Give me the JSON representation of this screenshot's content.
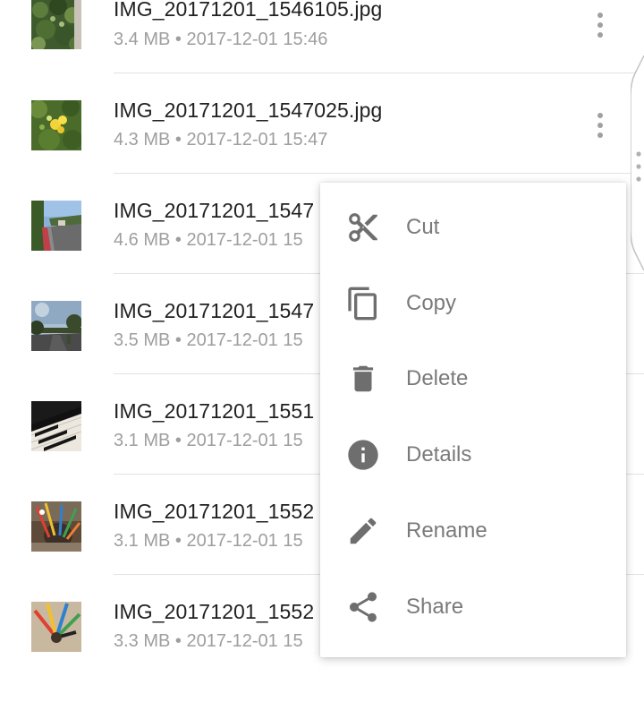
{
  "files": [
    {
      "name": "IMG_20171201_1546105.jpg",
      "size": "3.4 MB",
      "date": "2017-12-01 15:46",
      "thumb": "ivy-wall"
    },
    {
      "name": "IMG_20171201_1547025.jpg",
      "size": "4.3 MB",
      "date": "2017-12-01 15:47",
      "thumb": "yellow-flowers"
    },
    {
      "name": "IMG_20171201_1547",
      "size": "4.6 MB",
      "date": "2017-12-01 15",
      "thumb": "street-curb"
    },
    {
      "name": "IMG_20171201_1547",
      "size": "3.5 MB",
      "date": "2017-12-01 15",
      "thumb": "road-sky"
    },
    {
      "name": "IMG_20171201_1551",
      "size": "3.1 MB",
      "date": "2017-12-01 15",
      "thumb": "piano-keys"
    },
    {
      "name": "IMG_20171201_1552",
      "size": "3.1 MB",
      "date": "2017-12-01 15",
      "thumb": "pencil-cup"
    },
    {
      "name": "IMG_20171201_1552",
      "size": "3.3 MB",
      "date": "2017-12-01 15",
      "thumb": "pencil-cup-closeup"
    }
  ],
  "meta_separator": "•",
  "context_menu": {
    "items": [
      {
        "label": "Cut",
        "icon": "scissors-icon"
      },
      {
        "label": "Copy",
        "icon": "copy-icon"
      },
      {
        "label": "Delete",
        "icon": "trash-icon"
      },
      {
        "label": "Details",
        "icon": "info-icon"
      },
      {
        "label": "Rename",
        "icon": "pencil-icon"
      },
      {
        "label": "Share",
        "icon": "share-icon"
      }
    ]
  },
  "colors": {
    "text_primary": "#212121",
    "text_secondary": "#9e9e9e",
    "menu_text": "#7a7a7a",
    "menu_icon": "#6e6e6e",
    "divider": "#e2e2e2"
  }
}
